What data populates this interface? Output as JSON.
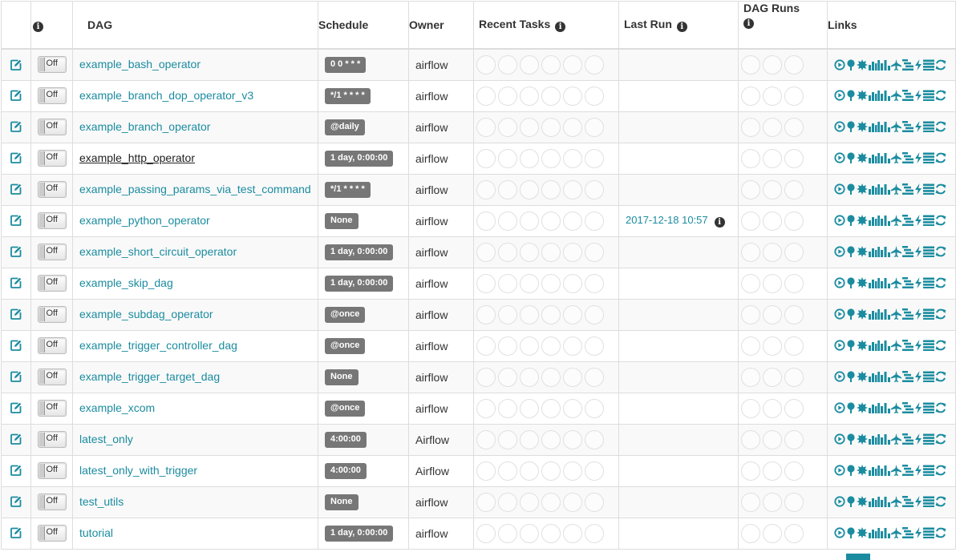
{
  "header": {
    "info_icon": "info-icon",
    "dag": "DAG",
    "schedule": "Schedule",
    "owner": "Owner",
    "recent_tasks": "Recent Tasks",
    "last_run": "Last Run",
    "dag_runs": "DAG Runs",
    "links": "Links"
  },
  "toggle_label": "Off",
  "colors": {
    "link": "#1b8ca0",
    "badge": "#777777",
    "stripe": "#f9f9f9"
  },
  "rows": [
    {
      "dag": "example_bash_operator",
      "schedule": "0 0 * * *",
      "owner": "airflow",
      "last_run": ""
    },
    {
      "dag": "example_branch_dop_operator_v3",
      "schedule": "*/1 * * * *",
      "owner": "airflow",
      "last_run": ""
    },
    {
      "dag": "example_branch_operator",
      "schedule": "@daily",
      "owner": "airflow",
      "last_run": ""
    },
    {
      "dag": "example_http_operator",
      "schedule": "1 day, 0:00:00",
      "owner": "airflow",
      "last_run": ""
    },
    {
      "dag": "example_passing_params_via_test_command",
      "schedule": "*/1 * * * *",
      "owner": "airflow",
      "last_run": ""
    },
    {
      "dag": "example_python_operator",
      "schedule": "None",
      "owner": "airflow",
      "last_run": "2017-12-18 10:57"
    },
    {
      "dag": "example_short_circuit_operator",
      "schedule": "1 day, 0:00:00",
      "owner": "airflow",
      "last_run": ""
    },
    {
      "dag": "example_skip_dag",
      "schedule": "1 day, 0:00:00",
      "owner": "airflow",
      "last_run": ""
    },
    {
      "dag": "example_subdag_operator",
      "schedule": "@once",
      "owner": "airflow",
      "last_run": ""
    },
    {
      "dag": "example_trigger_controller_dag",
      "schedule": "@once",
      "owner": "airflow",
      "last_run": ""
    },
    {
      "dag": "example_trigger_target_dag",
      "schedule": "None",
      "owner": "airflow",
      "last_run": ""
    },
    {
      "dag": "example_xcom",
      "schedule": "@once",
      "owner": "airflow",
      "last_run": ""
    },
    {
      "dag": "latest_only",
      "schedule": "4:00:00",
      "owner": "Airflow",
      "last_run": ""
    },
    {
      "dag": "latest_only_with_trigger",
      "schedule": "4:00:00",
      "owner": "Airflow",
      "last_run": ""
    },
    {
      "dag": "test_utils",
      "schedule": "None",
      "owner": "airflow",
      "last_run": ""
    },
    {
      "dag": "tutorial",
      "schedule": "1 day, 0:00:00",
      "owner": "airflow",
      "last_run": ""
    }
  ],
  "link_icons": [
    "trigger-dag-icon",
    "tree-view-icon",
    "graph-view-icon",
    "task-duration-icon",
    "task-tries-icon",
    "landing-times-icon",
    "gantt-icon",
    "code-view-icon",
    "logs-icon",
    "refresh-icon"
  ]
}
